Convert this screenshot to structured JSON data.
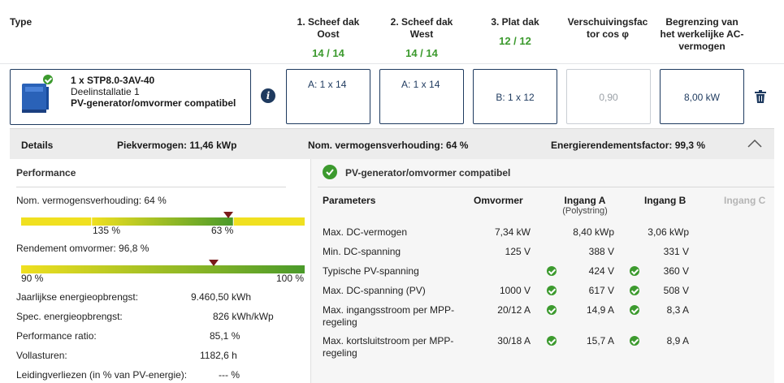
{
  "header": {
    "type_label": "Type",
    "columns": [
      {
        "label": "1. Scheef dak Oost",
        "count": "14 / 14"
      },
      {
        "label": "2. Scheef dak West",
        "count": "14 / 14"
      },
      {
        "label": "3. Plat dak",
        "count": "12 / 12"
      },
      {
        "label": "Verschuivingsfac tor cos φ",
        "count": ""
      },
      {
        "label": "Begrenzing van het werkelijke AC-vermogen",
        "count": ""
      }
    ]
  },
  "inverter": {
    "model": "1 x STP8.0-3AV-40",
    "subinstallation": "Deelinstallatie 1",
    "status": "PV-generator/omvormer compatibel",
    "assignments": [
      "A: 1 x 14",
      "A: 1 x 14",
      "B: 1 x 12"
    ],
    "cos_phi": "0,90",
    "ac_limit": "8,00 kW"
  },
  "details_bar": {
    "label": "Details",
    "peak_power": "Piekvermogen: 11,46 kWp",
    "nominal_ratio": "Nom. vermogensverhouding: 64 %",
    "energy_yield_factor": "Energierendementsfactor: 99,3 %"
  },
  "performance": {
    "title": "Performance",
    "nominal_ratio_label": "Nom. vermogensverhouding: 64 %",
    "nominal_bar": {
      "left_label": "135 %",
      "right_label": "63 %",
      "marker": 0.73
    },
    "efficiency_label": "Rendement omvormer: 96,8 %",
    "efficiency_bar": {
      "left_label": "90 %",
      "right_label": "100 %",
      "marker": 0.68
    },
    "stats": [
      {
        "label": "Jaarlijkse energieopbrengst:",
        "value": "9.460,50 kWh"
      },
      {
        "label": "Spec. energieopbrengst:",
        "value": "826 kWh/kWp"
      },
      {
        "label": "Performance ratio:",
        "value": "85,1 %"
      },
      {
        "label": "Vollasturen:",
        "value": "1182,6 h"
      },
      {
        "label": "Leidingverliezen (in % van PV-energie):",
        "value": "--- %"
      }
    ],
    "colors": {
      "yellow": "#f0e020",
      "green": "#4a9a2a",
      "marker": "#7a1a1a"
    }
  },
  "compat": {
    "title": "PV-generator/omvormer compatibel",
    "headers": {
      "params": "Parameters",
      "inverter": "Omvormer",
      "input_a": "Ingang A",
      "input_a_sub": "(Polystring)",
      "input_b": "Ingang B",
      "input_c": "Ingang C"
    },
    "rows": [
      {
        "label": "Max. DC-vermogen",
        "inverter": "7,34 kW",
        "a": "8,40 kWp",
        "a_ok": false,
        "b": "3,06 kWp",
        "b_ok": false
      },
      {
        "label": "Min. DC-spanning",
        "inverter": "125 V",
        "a": "388 V",
        "a_ok": false,
        "b": "331 V",
        "b_ok": false
      },
      {
        "label": "Typische PV-spanning",
        "inverter": "",
        "a": "424 V",
        "a_ok": true,
        "b": "360 V",
        "b_ok": true
      },
      {
        "label": "Max. DC-spanning (PV)",
        "inverter": "1000 V",
        "a": "617 V",
        "a_ok": true,
        "b": "508 V",
        "b_ok": true
      },
      {
        "label": "Max. ingangsstroom per MPP-regeling",
        "inverter": "20/12 A",
        "a": "14,9 A",
        "a_ok": true,
        "b": "8,3 A",
        "b_ok": true
      },
      {
        "label": "Max. kortsluitstroom per MPP-regeling",
        "inverter": "30/18 A",
        "a": "15,7 A",
        "a_ok": true,
        "b": "8,9 A",
        "b_ok": true
      }
    ]
  }
}
